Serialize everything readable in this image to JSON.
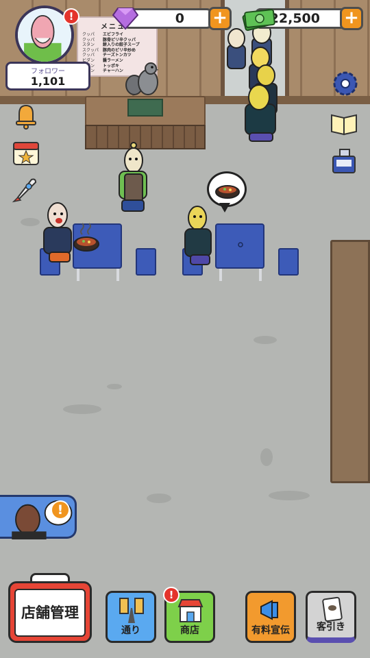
{
  "hud": {
    "followers_label": "フォロワー",
    "followers_value": "1,101",
    "gems_value": "0",
    "cash_value": "22,500",
    "plus_symbol": "+",
    "alert_symbol": "!"
  },
  "menu_board": {
    "title": "メニュー",
    "left_items": [
      "クッパ",
      "クッパ",
      "スタン",
      "スクッパ",
      "クッパ",
      "ビダン",
      "ビダン",
      "ンタン"
    ],
    "right_items": [
      "エビフライ",
      "豚骨ピリ辛クッパ",
      "餅入りの餃子スープ",
      "豚肉のピリ辛炒め",
      "チーズトンカツ",
      "醤ラーメン",
      "トッポキ",
      "チャーハン"
    ]
  },
  "bottom_bar": {
    "manage_label": "店舗管理",
    "street_label": "通り",
    "shop_label": "商店",
    "ads_label": "有料宣伝",
    "invite_label": "客引き"
  },
  "icons": {
    "avatar": "bald-man-avatar-icon",
    "gem": "purple-gem-icon",
    "cash": "cash-stack-icon",
    "settings": "gear-icon",
    "book": "book-icon",
    "register": "cash-register-icon",
    "bell": "bell-icon",
    "calendar": "calendar-star-icon",
    "rocket": "rocket-icon",
    "food": "bibimbap-bowl-icon"
  },
  "colors": {
    "accent_orange": "#f0951f",
    "alert_red": "#e4342c",
    "street_blue": "#5aa9f0",
    "shop_green": "#7ed04a",
    "ads_orange": "#f29a2e",
    "invite_gray": "#d3d3d3",
    "manage_red": "#e64536"
  }
}
